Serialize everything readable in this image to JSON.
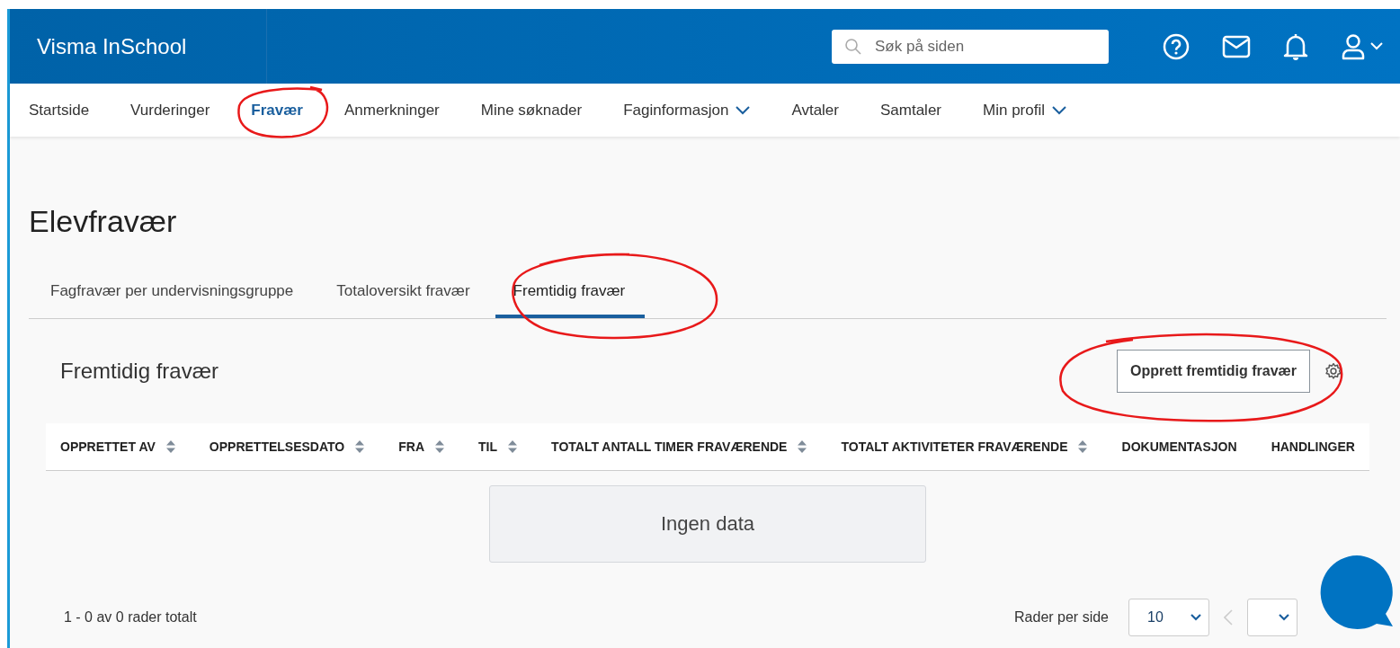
{
  "header": {
    "brand": "Visma InSchool",
    "search": {
      "placeholder": "Søk på siden"
    }
  },
  "nav": [
    {
      "label": "Startside",
      "selected": false,
      "dropdown": false
    },
    {
      "label": "Vurderinger",
      "selected": false,
      "dropdown": false
    },
    {
      "label": "Fravær",
      "selected": true,
      "dropdown": false
    },
    {
      "label": "Anmerkninger",
      "selected": false,
      "dropdown": false
    },
    {
      "label": "Mine søknader",
      "selected": false,
      "dropdown": false
    },
    {
      "label": "Faginformasjon",
      "selected": false,
      "dropdown": true
    },
    {
      "label": "Avtaler",
      "selected": false,
      "dropdown": false
    },
    {
      "label": "Samtaler",
      "selected": false,
      "dropdown": false
    },
    {
      "label": "Min profil",
      "selected": false,
      "dropdown": true
    }
  ],
  "page_title": "Elevfravær",
  "tabs": [
    {
      "label": "Fagfravær per undervisningsgruppe",
      "selected": false
    },
    {
      "label": "Totaloversikt fravær",
      "selected": false
    },
    {
      "label": "Fremtidig fravær",
      "selected": true
    }
  ],
  "section": {
    "title": "Fremtidig fravær",
    "create_button": "Opprett fremtidig fravær"
  },
  "table": {
    "columns": [
      {
        "label": "OPPRETTET AV",
        "sortable": true
      },
      {
        "label": "OPPRETTELSESDATO",
        "sortable": true
      },
      {
        "label": "FRA",
        "sortable": true
      },
      {
        "label": "TIL",
        "sortable": true
      },
      {
        "label": "TOTALT ANTALL TIMER FRAVÆRENDE",
        "sortable": true
      },
      {
        "label": "TOTALT AKTIVITETER FRAVÆRENDE",
        "sortable": true
      },
      {
        "label": "DOKUMENTASJON",
        "sortable": false
      },
      {
        "label": "HANDLINGER",
        "sortable": false
      }
    ],
    "empty_message": "Ingen data"
  },
  "footer": {
    "summary": "1 - 0 av 0 rader totalt",
    "rows_per_page_label": "Rader per side",
    "rows_per_page": "10"
  }
}
